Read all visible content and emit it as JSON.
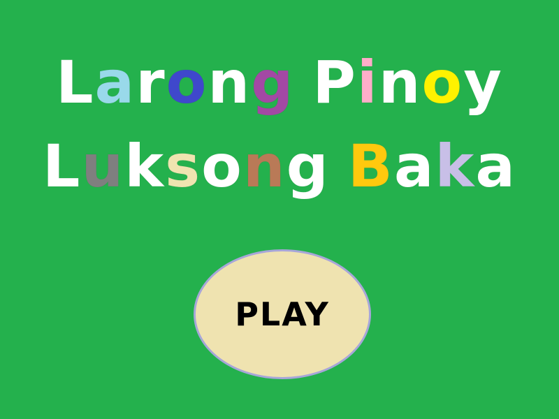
{
  "background_color": "#24b14d",
  "title": {
    "line1": {
      "text": "Larong Pinoy",
      "letters": [
        {
          "char": "L",
          "color": "#ffffff"
        },
        {
          "char": "a",
          "color": "#99d9ea"
        },
        {
          "char": "r",
          "color": "#ffffff"
        },
        {
          "char": "o",
          "color": "#3f48cc"
        },
        {
          "char": "n",
          "color": "#ffffff"
        },
        {
          "char": "g",
          "color": "#a349a4"
        },
        {
          "char": " ",
          "color": "#ffffff"
        },
        {
          "char": "P",
          "color": "#ffffff"
        },
        {
          "char": "i",
          "color": "#ffaec9"
        },
        {
          "char": "n",
          "color": "#ffffff"
        },
        {
          "char": "o",
          "color": "#fff200"
        },
        {
          "char": "y",
          "color": "#ffffff"
        }
      ]
    },
    "line2": {
      "text": "Luksong Baka",
      "letters": [
        {
          "char": "L",
          "color": "#ffffff"
        },
        {
          "char": "u",
          "color": "#7f7f7f"
        },
        {
          "char": "k",
          "color": "#ffffff"
        },
        {
          "char": "s",
          "color": "#efe4b0"
        },
        {
          "char": "o",
          "color": "#ffffff"
        },
        {
          "char": "n",
          "color": "#b97a57"
        },
        {
          "char": "g",
          "color": "#ffffff"
        },
        {
          "char": " ",
          "color": "#ffffff"
        },
        {
          "char": "B",
          "color": "#ffc90e"
        },
        {
          "char": "a",
          "color": "#ffffff"
        },
        {
          "char": "k",
          "color": "#c8bfe7"
        },
        {
          "char": "a",
          "color": "#ffffff"
        }
      ]
    }
  },
  "play_button": {
    "label": "PLAY",
    "fill_color": "#efe3b0",
    "border_color": "#a7a6d9"
  }
}
